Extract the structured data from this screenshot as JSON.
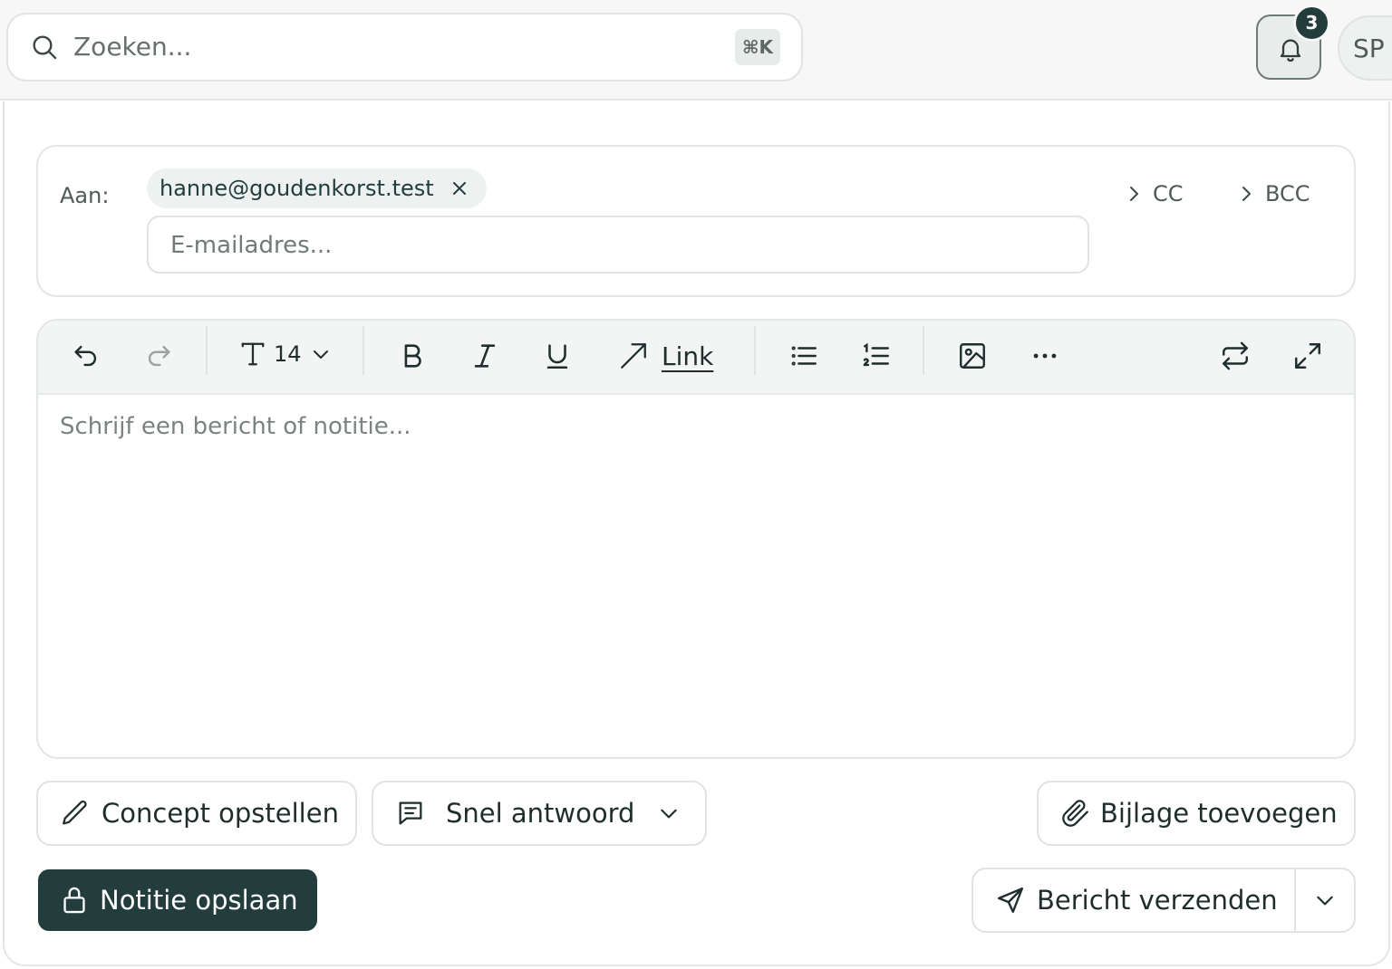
{
  "header": {
    "search_placeholder": "Zoeken...",
    "search_shortcut": "⌘K",
    "notification_count": "3",
    "avatar_initials": "SP"
  },
  "recipients": {
    "to_label": "Aan:",
    "chips": [
      "hanne@goudenkorst.test"
    ],
    "email_placeholder": "E-mailadres...",
    "cc_label": "CC",
    "bcc_label": "BCC"
  },
  "toolbar": {
    "font_size": "14",
    "link_label": "Link"
  },
  "editor": {
    "placeholder": "Schrijf een bericht of notitie..."
  },
  "actions": {
    "draft_label": "Concept opstellen",
    "quick_reply_label": "Snel antwoord",
    "attach_label": "Bijlage toevoegen",
    "save_note_label": "Notitie opslaan",
    "send_label": "Bericht verzenden"
  },
  "colors": {
    "primary": "#233c3c",
    "border": "#dfe3e1",
    "toolbar_bg": "#f3f5f4"
  }
}
